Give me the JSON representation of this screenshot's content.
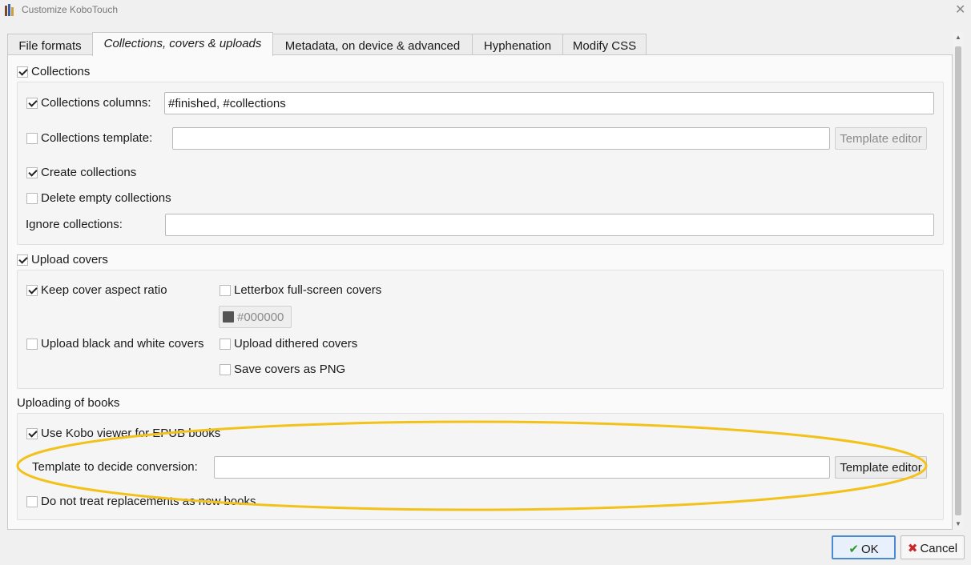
{
  "window": {
    "title": "Customize KoboTouch",
    "close_glyph": "✕",
    "icon": "calibre-books-icon",
    "icon_colors": [
      "#7a4a2a",
      "#3a5fa8",
      "#c8a040"
    ]
  },
  "tabs": [
    {
      "label": "File formats",
      "active": false
    },
    {
      "label": "Collections, covers & uploads",
      "active": true
    },
    {
      "label": "Metadata, on device & advanced",
      "active": false
    },
    {
      "label": "Hyphenation",
      "active": false
    },
    {
      "label": "Modify CSS",
      "active": false
    }
  ],
  "collections": {
    "label": "Collections",
    "checked": true,
    "columns_label": "Collections columns:",
    "columns_checked": true,
    "columns_value": "#finished, #collections",
    "template_label": "Collections template:",
    "template_checked": false,
    "template_value": "",
    "template_editor_label": "Template editor",
    "template_editor_enabled": false,
    "create_label": "Create collections",
    "create_checked": true,
    "delete_empty_label": "Delete empty collections",
    "delete_empty_checked": false,
    "ignore_label": "Ignore collections:",
    "ignore_value": ""
  },
  "covers": {
    "label": "Upload covers",
    "checked": true,
    "keep_aspect_label": "Keep cover aspect ratio",
    "keep_aspect_checked": true,
    "letterbox_label": "Letterbox full-screen covers",
    "letterbox_checked": false,
    "letterbox_color": "#000000",
    "letterbox_color_swatch": "#555555",
    "bw_label": "Upload black and white covers",
    "bw_checked": false,
    "dithered_label": "Upload dithered covers",
    "dithered_checked": false,
    "png_label": "Save covers as PNG",
    "png_checked": false
  },
  "uploading": {
    "label": "Uploading of books",
    "kobo_viewer_label": "Use Kobo viewer for EPUB books",
    "kobo_viewer_checked": true,
    "template_label": "Template to decide conversion:",
    "template_value": "",
    "template_editor_label": "Template editor",
    "template_editor_enabled": true,
    "no_replacements_label": "Do not treat replacements as new books",
    "no_replacements_checked": false
  },
  "annotation": {
    "shape": "ellipse",
    "color": "#f2c21b"
  },
  "footer": {
    "ok_label": "OK",
    "ok_icon": "✔",
    "ok_color": "#2e9a2e",
    "cancel_label": "Cancel",
    "cancel_icon": "✖",
    "cancel_color": "#c8282a"
  }
}
